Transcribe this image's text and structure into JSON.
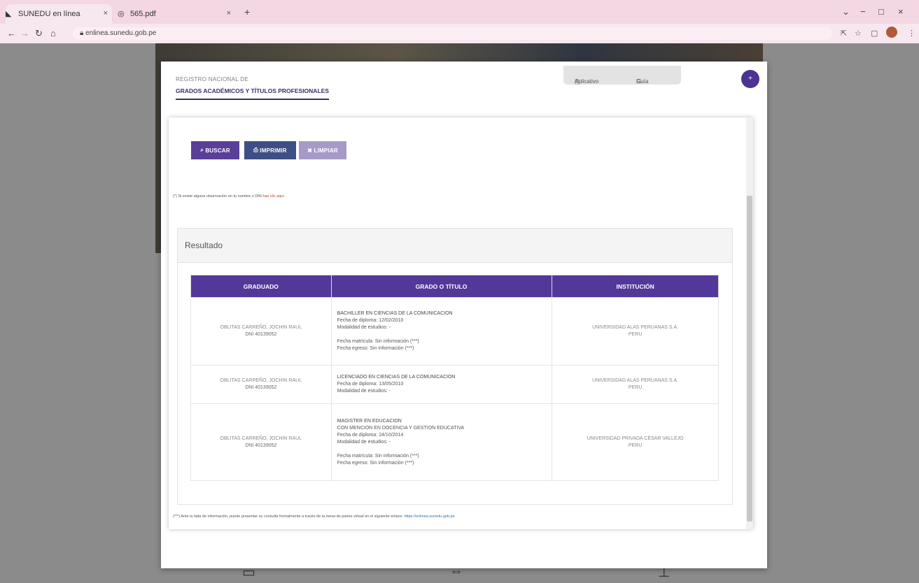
{
  "browser": {
    "tabs": [
      {
        "title": "SUNEDU en línea",
        "icon": "sunedu-favicon"
      },
      {
        "title": "565.pdf",
        "icon": "globe-icon"
      }
    ],
    "new_tab": "+",
    "url": "enlinea.sunedu.gob.pe",
    "window_controls": {
      "minimize": "−",
      "maximize": "□",
      "close": "×",
      "tabsearch": "⌄"
    }
  },
  "header": {
    "registro": "REGISTRO NACIONAL DE",
    "title": "GRADOS ACADÉMICOS Y TÍTULOS PROFESIONALES",
    "tabs": [
      {
        "label": "Aplicativo",
        "icon": "document-icon"
      },
      {
        "label": "Guía",
        "icon": "list-icon"
      }
    ],
    "round_button": "+"
  },
  "actions": {
    "buscar": "BUSCAR",
    "imprimir": "IMPRIMIR",
    "limpiar": "LIMPIAR"
  },
  "observacion": {
    "text": "(*) Si existe alguna observación en tu nombre o DNI ",
    "link": "haz clic aquí"
  },
  "resultado": {
    "title": "Resultado",
    "columns": [
      "GRADUADO",
      "GRADO O TÍTULO",
      "INSTITUCIÓN"
    ],
    "rows": [
      {
        "graduado": "OBLITAS CARREÑO, JOCHIN RAUL",
        "dni": "DNI 40139052",
        "grado": "BACHILLER EN CIENCIAS DE LA COMUNICACION",
        "lines": [
          "Fecha de diploma: 12/02/2010",
          "Modalidad de estudios: -",
          "",
          "Fecha matrícula: Sin información (***)",
          "Fecha egreso: Sin información (***)"
        ],
        "institucion": "UNIVERSIDAD ALAS PERUANAS S.A.",
        "pais": "PERU"
      },
      {
        "graduado": "OBLITAS CARREÑO, JOCHIN RAUL",
        "dni": "DNI 40139052",
        "grado": "LICENCIADO EN CIENCIAS DE LA COMUNICACION",
        "lines": [
          "Fecha de diploma: 13/05/2010",
          "Modalidad de estudios: -"
        ],
        "institucion": "UNIVERSIDAD ALAS PERUANAS S.A.",
        "pais": "PERU"
      },
      {
        "graduado": "OBLITAS CARREÑO, JOCHIN RAUL",
        "dni": "DNI 40139052",
        "grado": "MAGISTER EN EDUCACION",
        "lines": [
          "CON MENCION EN DOCENCIA Y GESTION EDUCATIVA",
          "Fecha de diploma: 24/10/2014",
          "Modalidad de estudios: -",
          "",
          "Fecha matrícula: Sin información (***)",
          "Fecha egreso: Sin información (***)"
        ],
        "institucion": "UNIVERSIDAD PRIVADA CÉSAR VALLEJO",
        "pais": "PERU"
      }
    ]
  },
  "footer": {
    "text": "(***) Ante la falta de información, puede presentar su consulta formalmente a través de la mesa de partes virtual en el siguiente enlace: ",
    "link": "https://enlinea.sunedu.gob.pe"
  }
}
